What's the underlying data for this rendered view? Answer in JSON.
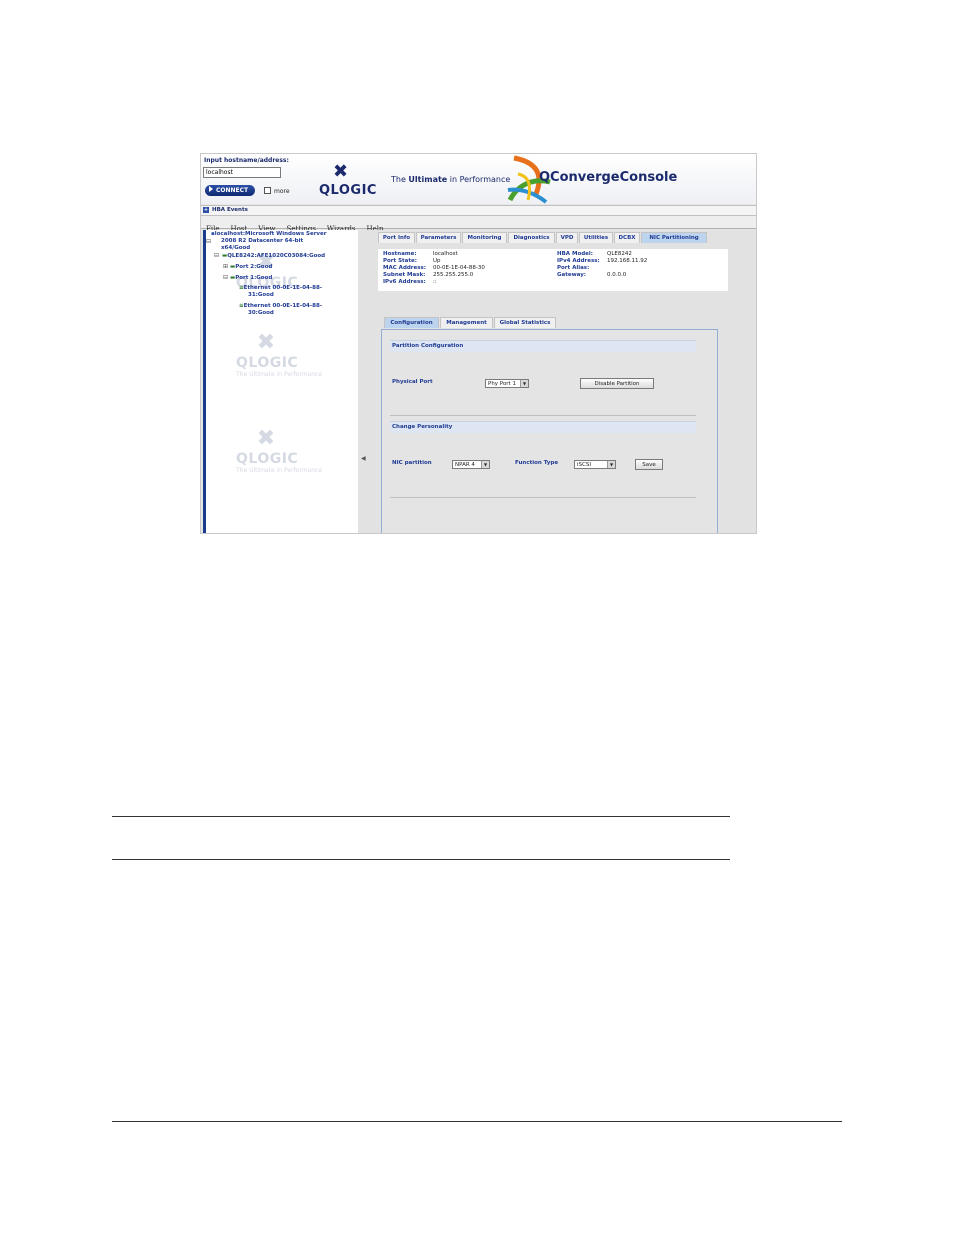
{
  "header": {
    "input_label": "Input hostname/address:",
    "hostname_value": "localhost",
    "connect_label": "CONNECT",
    "more_label": "more",
    "logo_text": "QLOGIC",
    "tagline_pre": "The ",
    "tagline_bold": "Ultimate",
    "tagline_post": " in Performance",
    "brand": "QConvergeConsole"
  },
  "hba_events": {
    "label": "HBA Events"
  },
  "menu": [
    "File",
    "Host",
    "View",
    "Settings",
    "Wizards",
    "Help"
  ],
  "tree": {
    "host": "localhost:Microsoft Windows Server",
    "host_line2": "2008 R2 Datacenter 64-bit",
    "host_line3": "x64/Good",
    "adapter": "QLE8242:AFE1020C03084:Good",
    "port2": "Port 2:Good",
    "port1": "Port 1:Good",
    "eth1_line1": "Ethernet 00-0E-1E-04-88-",
    "eth1_line2": "31:Good",
    "eth2_line1": "Ethernet 00-0E-1E-04-88-",
    "eth2_line2": "30:Good",
    "watermark_word": "QLOGIC",
    "watermark_tagline": "The Ultimate in Performance"
  },
  "tabs": [
    "Port Info",
    "Parameters",
    "Monitoring",
    "Diagnostics",
    "VPD",
    "Utilities",
    "DCBX",
    "NIC Partitioning"
  ],
  "info": {
    "hostname_k": "Hostname:",
    "hostname_v": "localhost",
    "port_state_k": "Port State:",
    "port_state_v": "Up",
    "mac_k": "MAC Address:",
    "mac_v": "00-0E-1E-04-88-30",
    "subnet_k": "Subnet Mask:",
    "subnet_v": "255.255.255.0",
    "ipv6_k": "IPv6 Address:",
    "ipv6_v": "::",
    "hba_model_k": "HBA Model:",
    "hba_model_v": "QLE8242",
    "ipv4_k": "IPv4 Address:",
    "ipv4_v": "192.168.11.92",
    "alias_k": "Port Alias:",
    "alias_v": "",
    "gateway_k": "Gateway:",
    "gateway_v": "0.0.0.0"
  },
  "subtabs": [
    "Configuration",
    "Management",
    "Global Statistics"
  ],
  "partition_config": {
    "heading": "Partition Configuration",
    "physical_port_label": "Physical Port",
    "physical_port_value": "Phy Port 1",
    "disable_button": "Disable Partition"
  },
  "change_personality": {
    "heading": "Change Personality",
    "nic_partition_label": "NIC partition",
    "nic_partition_value": "NPAR 4",
    "function_type_label": "Function Type",
    "function_type_value": "iSCSI",
    "save_button": "Save"
  },
  "colors": {
    "accent": "#1f3a93",
    "active_tab": "#bcd4ee"
  }
}
